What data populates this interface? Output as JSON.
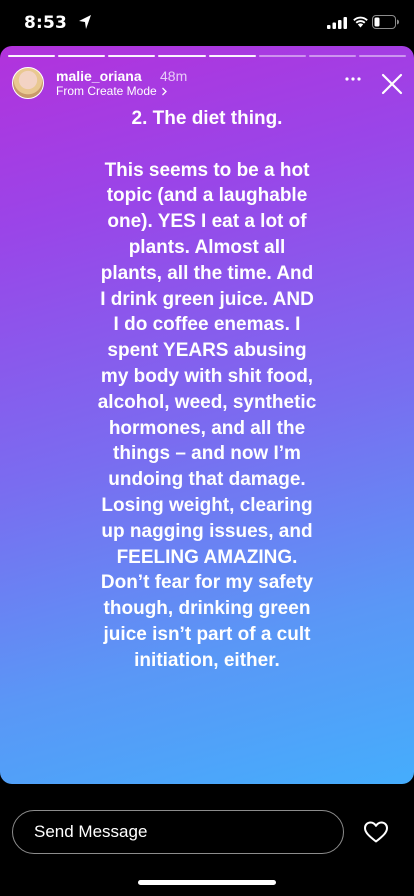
{
  "status_bar": {
    "time": "8:53",
    "icons": [
      "location-arrow-icon",
      "cellular-signal-icon",
      "wifi-icon",
      "battery-icon"
    ]
  },
  "story": {
    "segments_total": 8,
    "segments_done": 5,
    "author": {
      "username": "malie_oriana",
      "time_ago": "48m",
      "subtitle": "From Create Mode"
    },
    "text": "2.       The diet thing.\n\nThis seems to be a hot\ntopic (and a laughable\none). YES I eat a lot of\nplants. Almost all\nplants, all the time. And\nI drink green juice. AND\nI do coffee enemas. I\nspent YEARS abusing\nmy body with shit food,\nalcohol, weed, synthetic\nhormones, and all the\nthings – and now I’m\nundoing that damage.\nLosing weight, clearing\nup nagging issues, and\nFEELING AMAZING.\nDon’t fear for my safety\nthough, drinking green\njuice isn’t part of a cult\ninitiation, either.",
    "gradient_colors": [
      "#b232dc",
      "#9a45e8",
      "#7a6cf0",
      "#5a97f6",
      "#45adfc"
    ]
  },
  "reply": {
    "placeholder": "Send Message"
  }
}
